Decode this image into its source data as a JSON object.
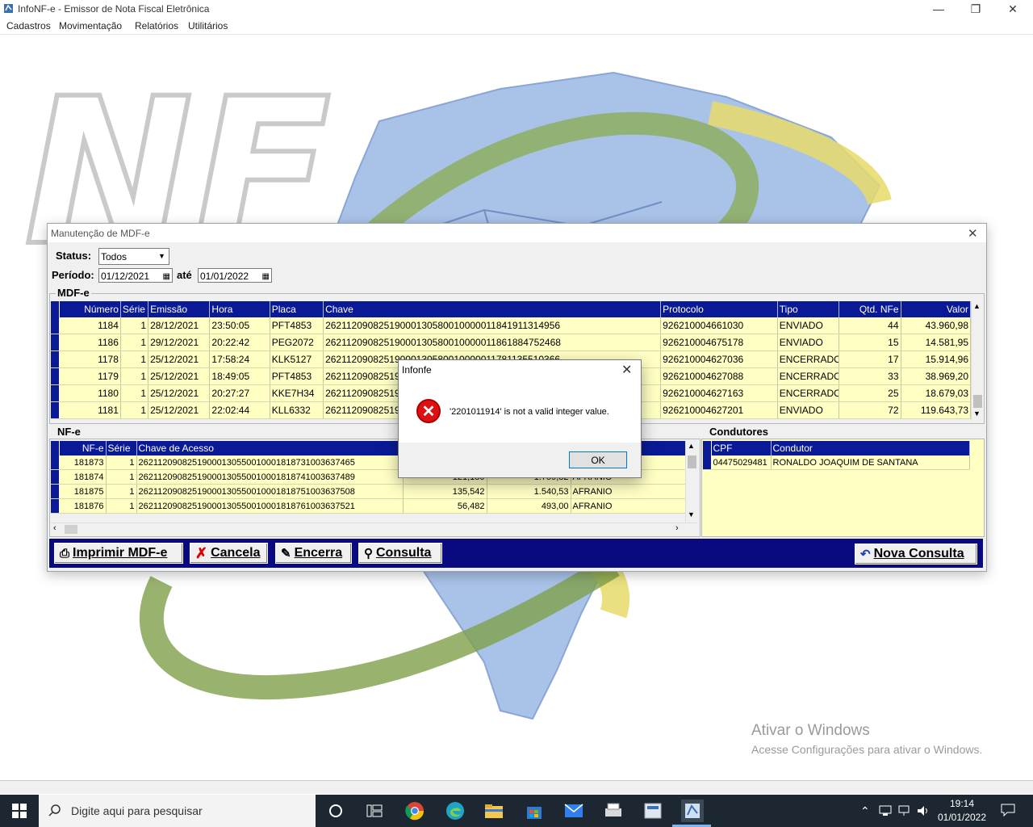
{
  "app": {
    "title": "InfoNF-e - Emissor de Nota Fiscal Eletrônica",
    "menu": [
      "Cadastros",
      "Movimentação",
      "Relatórios",
      "Utilitários"
    ]
  },
  "activation": {
    "title": "Ativar o Windows",
    "subtitle": "Acesse Configurações para ativar o Windows."
  },
  "taskbar": {
    "search_placeholder": "Digite aqui para pesquisar",
    "time": "19:14",
    "date": "01/01/2022"
  },
  "mdfe_window": {
    "title": "Manutenção de MDF-e",
    "status_label": "Status:",
    "status_value": "Todos",
    "periodo_label": "Período:",
    "periodo_start": "01/12/2021",
    "ate_label": "até",
    "periodo_end": "01/01/2022",
    "mdfe_group": "MDF-e",
    "mdfe_columns": [
      "Número",
      "Série",
      "Emissão",
      "Hora",
      "Placa",
      "Chave",
      "Protocolo",
      "Tipo",
      "Qtd. NFe",
      "Valor"
    ],
    "mdfe_rows": [
      [
        "1184",
        "1",
        "28/12/2021",
        "23:50:05",
        "PFT4853",
        "26211209082519000130580010000011841911314956",
        "926210004661030",
        "ENVIADO",
        "44",
        "43.960,98"
      ],
      [
        "1186",
        "1",
        "29/12/2021",
        "20:22:42",
        "PEG2072",
        "26211209082519000130580010000011861884752468",
        "926210004675178",
        "ENVIADO",
        "15",
        "14.581,95"
      ],
      [
        "1178",
        "1",
        "25/12/2021",
        "17:58:24",
        "KLK5127",
        "26211209082519000130580010000011781135510366",
        "926210004627036",
        "ENCERRADO",
        "17",
        "15.914,96"
      ],
      [
        "1179",
        "1",
        "25/12/2021",
        "18:49:05",
        "PFT4853",
        "26211209082519000130580010000011791202284811",
        "926210004627088",
        "ENCERRADO",
        "33",
        "38.969,20"
      ],
      [
        "1180",
        "1",
        "25/12/2021",
        "20:27:27",
        "KKE7H34",
        "26211209082519000130580010000011801419922557",
        "926210004627163",
        "ENCERRADO",
        "25",
        "18.679,03"
      ],
      [
        "1181",
        "1",
        "25/12/2021",
        "22:02:44",
        "KLL6332",
        "26211209082519000130580010000011811670231649",
        "926210004627201",
        "ENVIADO",
        "72",
        "119.643,73"
      ]
    ],
    "nfe_group": "NF-e",
    "nfe_columns": [
      "NF-e",
      "Série",
      "Chave de Acesso",
      "",
      "",
      ""
    ],
    "nfe_rows": [
      [
        "181873",
        "1",
        "26211209082519000130550010001818731003637465",
        "",
        "",
        ""
      ],
      [
        "181874",
        "1",
        "26211209082519000130550010001818741003637489",
        "121,180",
        "1.759,82",
        "AFRANIO"
      ],
      [
        "181875",
        "1",
        "26211209082519000130550010001818751003637508",
        "135,542",
        "1.540,53",
        "AFRANIO"
      ],
      [
        "181876",
        "1",
        "26211209082519000130550010001818761003637521",
        "56,482",
        "493,00",
        "AFRANIO"
      ]
    ],
    "condutores_group": "Condutores",
    "condutores_columns": [
      "CPF",
      "Condutor"
    ],
    "condutores_rows": [
      [
        "04475029481",
        "RONALDO JOAQUIM DE SANTANA"
      ]
    ],
    "buttons": {
      "imprimir": "Imprimir MDF-e",
      "cancela": "Cancela",
      "encerra": "Encerra",
      "consulta": "Consulta",
      "nova_consulta": "Nova Consulta"
    }
  },
  "dialog": {
    "title": "Infonfe",
    "message": "'2201011914' is not a valid integer value.",
    "ok": "OK"
  }
}
